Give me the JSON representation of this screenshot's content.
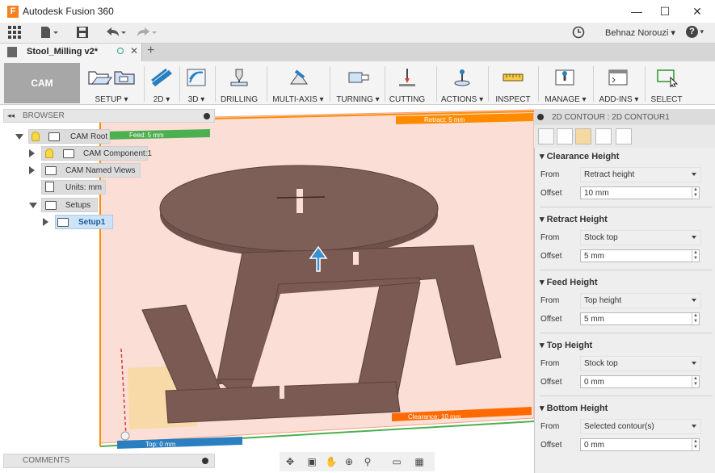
{
  "app": {
    "title": "Autodesk Fusion 360",
    "user": "Behnaz Norouzi",
    "help": "?"
  },
  "window": {
    "minimize": "—",
    "maximize": "☐",
    "close": "✕"
  },
  "document_tab": {
    "name": "Stool_Milling v2*"
  },
  "workspace": {
    "label": "CAM"
  },
  "ribbon": {
    "groups": [
      {
        "label": "SETUP ▾"
      },
      {
        "label": "2D ▾"
      },
      {
        "label": "3D ▾"
      },
      {
        "label": "DRILLING"
      },
      {
        "label": "MULTI-AXIS ▾"
      },
      {
        "label": "TURNING ▾"
      },
      {
        "label": "CUTTING"
      },
      {
        "label": "ACTIONS ▾"
      },
      {
        "label": "INSPECT"
      },
      {
        "label": "MANAGE ▾"
      },
      {
        "label": "ADD-INS ▾"
      },
      {
        "label": "SELECT"
      }
    ]
  },
  "browser": {
    "title": "BROWSER",
    "items": [
      {
        "label": "CAM Root"
      },
      {
        "label": "CAM Component:1"
      },
      {
        "label": "CAM Named Views"
      },
      {
        "label": "Units: mm"
      },
      {
        "label": "Setups"
      },
      {
        "label": "Setup1"
      }
    ]
  },
  "comments": {
    "title": "COMMENTS"
  },
  "viewport": {
    "labels": {
      "feed": "Feed: 5 mm",
      "retract": "Retract: 5 mm",
      "top": "Top: 0 mm",
      "clearance": "Clearance: 10 mm"
    }
  },
  "panel": {
    "title": "2D CONTOUR : 2D CONTOUR1",
    "sections": [
      {
        "title": "Clearance Height",
        "from_label": "From",
        "from": "Retract height",
        "offset_label": "Offset",
        "offset": "10 mm"
      },
      {
        "title": "Retract Height",
        "from_label": "From",
        "from": "Stock top",
        "offset_label": "Offset",
        "offset": "5 mm"
      },
      {
        "title": "Feed Height",
        "from_label": "From",
        "from": "Top height",
        "offset_label": "Offset",
        "offset": "5 mm"
      },
      {
        "title": "Top Height",
        "from_label": "From",
        "from": "Stock top",
        "offset_label": "Offset",
        "offset": "0 mm"
      },
      {
        "title": "Bottom Height",
        "from_label": "From",
        "from": "Selected contour(s)",
        "offset_label": "Offset",
        "offset": "0 mm"
      }
    ]
  },
  "colors": {
    "accent": "#f58220",
    "selection": "#cfe3f7",
    "plane": "#fbded6",
    "part": "#7a5a53"
  }
}
